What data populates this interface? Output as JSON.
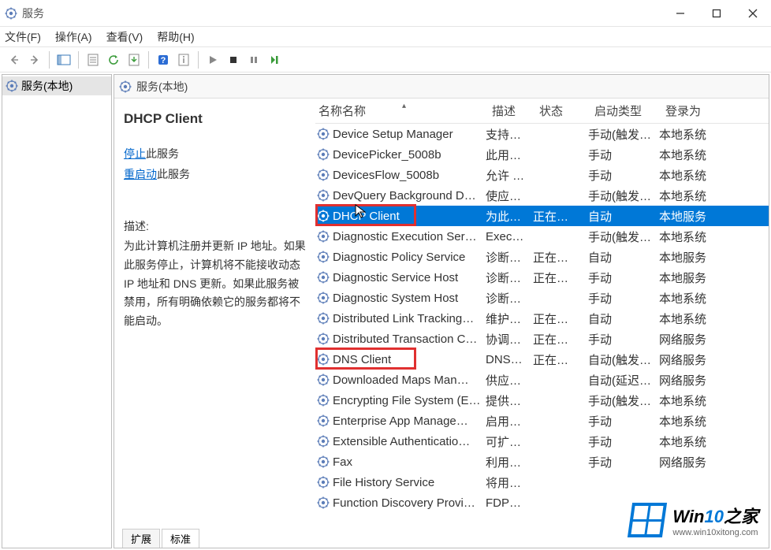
{
  "window": {
    "title": "服务"
  },
  "menu": {
    "file": "文件(F)",
    "action": "操作(A)",
    "view": "查看(V)",
    "help": "帮助(H)"
  },
  "nav": {
    "root": "服务(本地)"
  },
  "mainHead": "服务(本地)",
  "detail": {
    "name": "DHCP Client",
    "stopLink": "停止",
    "stopSuffix": "此服务",
    "restartLink": "重启动",
    "restartSuffix": "此服务",
    "descLabel": "描述:",
    "desc": "为此计算机注册并更新 IP 地址。如果此服务停止，计算机将不能接收动态 IP 地址和 DNS 更新。如果此服务被禁用，所有明确依赖它的服务都将不能启动。"
  },
  "columns": {
    "name": "名称",
    "desc": "描述",
    "status": "状态",
    "startup": "启动类型",
    "logon": "登录为"
  },
  "services": [
    {
      "name": "Device Setup Manager",
      "desc": "支持…",
      "status": "",
      "startup": "手动(触发…",
      "logon": "本地系统"
    },
    {
      "name": "DevicePicker_5008b",
      "desc": "此用…",
      "status": "",
      "startup": "手动",
      "logon": "本地系统"
    },
    {
      "name": "DevicesFlow_5008b",
      "desc": "允许 …",
      "status": "",
      "startup": "手动",
      "logon": "本地系统"
    },
    {
      "name": "DevQuery Background D…",
      "desc": "使应…",
      "status": "",
      "startup": "手动(触发…",
      "logon": "本地系统"
    },
    {
      "name": "DHCP Client",
      "desc": "为此…",
      "status": "正在…",
      "startup": "自动",
      "logon": "本地服务",
      "selected": true,
      "highlight": true
    },
    {
      "name": "Diagnostic Execution Ser…",
      "desc": "Exec…",
      "status": "",
      "startup": "手动(触发…",
      "logon": "本地系统"
    },
    {
      "name": "Diagnostic Policy Service",
      "desc": "诊断…",
      "status": "正在…",
      "startup": "自动",
      "logon": "本地服务"
    },
    {
      "name": "Diagnostic Service Host",
      "desc": "诊断…",
      "status": "正在…",
      "startup": "手动",
      "logon": "本地服务"
    },
    {
      "name": "Diagnostic System Host",
      "desc": "诊断…",
      "status": "",
      "startup": "手动",
      "logon": "本地系统"
    },
    {
      "name": "Distributed Link Tracking…",
      "desc": "维护…",
      "status": "正在…",
      "startup": "自动",
      "logon": "本地系统"
    },
    {
      "name": "Distributed Transaction C…",
      "desc": "协调…",
      "status": "正在…",
      "startup": "手动",
      "logon": "网络服务"
    },
    {
      "name": "DNS Client",
      "desc": "DNS…",
      "status": "正在…",
      "startup": "自动(触发…",
      "logon": "网络服务",
      "highlight": true
    },
    {
      "name": "Downloaded Maps Man…",
      "desc": "供应…",
      "status": "",
      "startup": "自动(延迟…",
      "logon": "网络服务"
    },
    {
      "name": "Encrypting File System (E…",
      "desc": "提供…",
      "status": "",
      "startup": "手动(触发…",
      "logon": "本地系统"
    },
    {
      "name": "Enterprise App Manage…",
      "desc": "启用…",
      "status": "",
      "startup": "手动",
      "logon": "本地系统"
    },
    {
      "name": "Extensible Authenticatio…",
      "desc": "可扩…",
      "status": "",
      "startup": "手动",
      "logon": "本地系统"
    },
    {
      "name": "Fax",
      "desc": "利用…",
      "status": "",
      "startup": "手动",
      "logon": "网络服务"
    },
    {
      "name": "File History Service",
      "desc": "将用…",
      "status": "",
      "startup": "",
      "logon": ""
    },
    {
      "name": "Function Discovery Provi…",
      "desc": "FDP…",
      "status": "",
      "startup": "",
      "logon": ""
    }
  ],
  "tabs": {
    "extended": "扩展",
    "standard": "标准"
  },
  "watermark": {
    "title_pre": "Win",
    "title_num": "10",
    "title_post": "之家",
    "url": "www.win10xitong.com"
  }
}
